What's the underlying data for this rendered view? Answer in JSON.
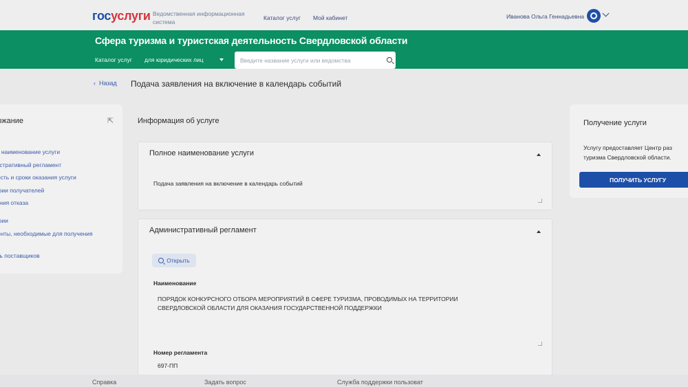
{
  "header": {
    "logo_part1": "гос",
    "logo_part2": "услуги",
    "logo_subtitle": "Ведомственная информационная система",
    "nav": [
      "Каталог услуг",
      "Мой кабинет"
    ],
    "user_name": "Иванова Ольга Геннадьевна",
    "brand_color": "#1d4fa8"
  },
  "band": {
    "title": "Сфера туризма и туристская деятельность Свердловской области",
    "catalog_label": "Каталог услуг",
    "audience_select": "для юридических лиц",
    "search_placeholder": "Введите название услуги или ведомства",
    "band_color": "#0b8f63"
  },
  "page": {
    "back_label": "Назад",
    "title": "Подача заявления на включение в календарь событий"
  },
  "toc": {
    "title": "ержание",
    "items": [
      "ое наименование услуги",
      "нистративный регламент",
      "мость и сроки оказания услуги",
      "гории получателей",
      "вания отказа",
      "гории",
      "менты, необходимые для получения",
      "и",
      "ень поставщиков"
    ]
  },
  "info": {
    "heading": "Информация об услуге",
    "full_name": {
      "heading": "Полное наименование услуги",
      "text": "Подача заявления на включение в календарь событий"
    },
    "regulation": {
      "heading": "Административный регламент",
      "open_label": "Открыть",
      "name_label": "Наименование",
      "name_line1": "ПОРЯДОК КОНКУРСНОГО ОТБОРА МЕРОПРИЯТИЙ В СФЕРЕ ТУРИЗМА, ПРОВОДИМЫХ НА ТЕРРИТОРИИ",
      "name_line2": "СВЕРДЛОВСКОЙ ОБЛАСТИ ДЛЯ ОКАЗАНИЯ ГОСУДАРСТВЕННОЙ ПОДДЕРЖКИ",
      "number_label": "Номер регламента",
      "number_value": "697-ПП"
    }
  },
  "side": {
    "title": "Получение услуги",
    "text_line1": "Услугу предоставляет Центр раз",
    "text_line2": "туризма Свердловской области.",
    "button_label": "ПОЛУЧИТЬ УСЛУГУ"
  },
  "footer": {
    "links": [
      "Справка",
      "Задать вопрос",
      "Служба поддержки пользоват"
    ]
  }
}
